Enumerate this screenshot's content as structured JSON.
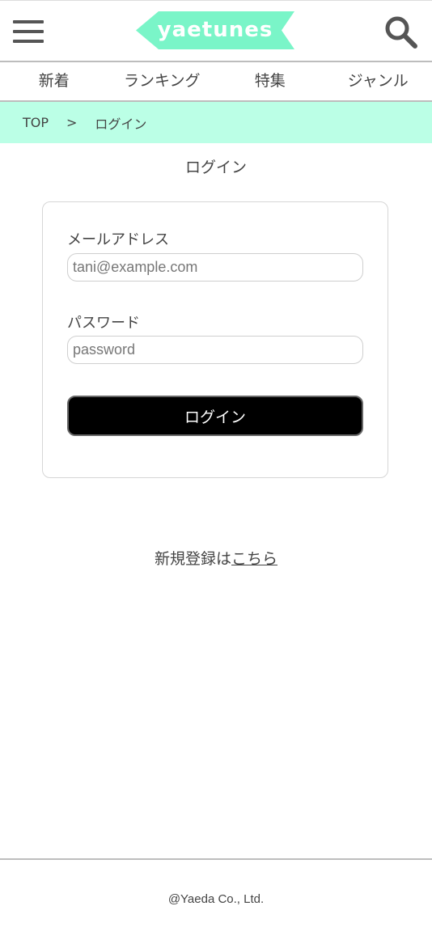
{
  "header": {
    "logo_text": "yaetunes",
    "menu_icon": "hamburger-icon",
    "search_icon": "search-icon",
    "logo_color": "#7af5c8"
  },
  "nav": {
    "items": [
      "新着",
      "ランキング",
      "特集",
      "ジャンル"
    ]
  },
  "breadcrumb": {
    "top": "TOP",
    "separator": ">",
    "current": "ログイン",
    "background": "#bbffe6"
  },
  "page": {
    "title": "ログイン"
  },
  "form": {
    "email_label": "メールアドレス",
    "email_placeholder": "tani@example.com",
    "password_label": "パスワード",
    "password_placeholder": "password",
    "submit_label": "ログイン"
  },
  "register": {
    "prefix": "新規登録は",
    "link": "こちら"
  },
  "footer": {
    "copyright": "@Yaeda Co., Ltd."
  }
}
